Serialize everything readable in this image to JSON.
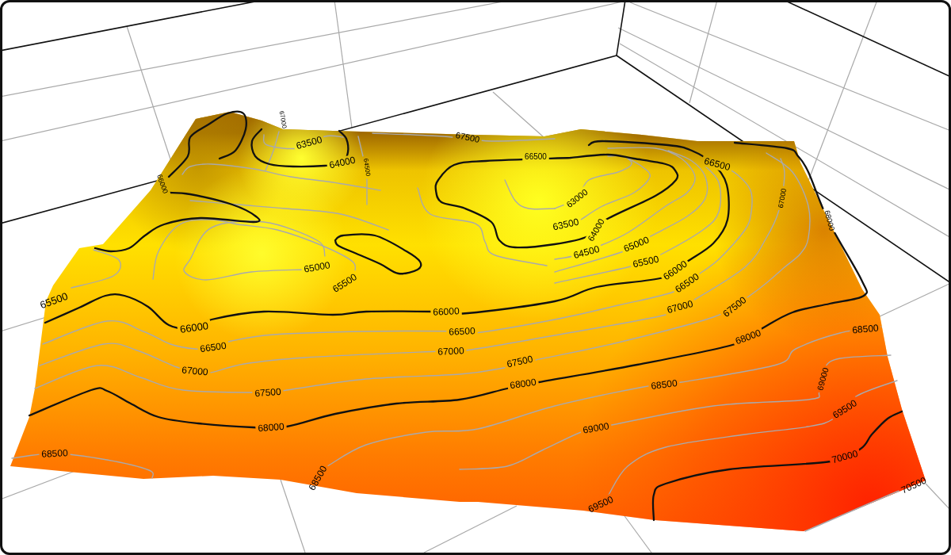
{
  "figure": {
    "contour_labels": [
      "67000",
      "63500",
      "67500",
      "64000",
      "64500",
      "66500",
      "66500",
      "66000",
      "63000",
      "67000",
      "68000",
      "63500",
      "64000",
      "65000",
      "64500",
      "65500",
      "65000",
      "66000",
      "65500",
      "66500",
      "65500",
      "67000",
      "67500",
      "66000",
      "66000",
      "68500",
      "66500",
      "66500",
      "68000",
      "67000",
      "67000",
      "67500",
      "68000",
      "68500",
      "69000",
      "67500",
      "69500",
      "68000",
      "69000",
      "68500",
      "70000",
      "68500",
      "70500",
      "69500"
    ]
  }
}
